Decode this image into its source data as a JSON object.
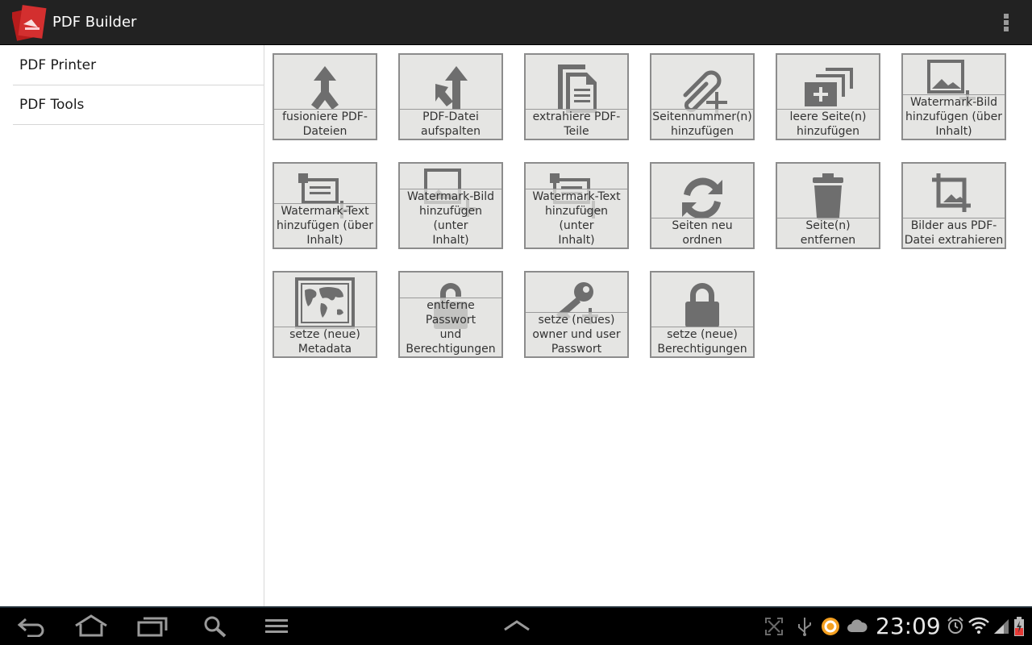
{
  "app": {
    "title": "PDF Builder",
    "icon": "pdf-app-icon"
  },
  "action_bar": {
    "overflow_icon": "overflow-menu-icon"
  },
  "sidebar": {
    "items": [
      {
        "label": "PDF Printer"
      },
      {
        "label": "PDF Tools"
      }
    ]
  },
  "tools": [
    {
      "label": "fusioniere PDF-\nDateien",
      "icon": "merge-icon"
    },
    {
      "label": "PDF-Datei\naufspalten",
      "icon": "split-icon"
    },
    {
      "label": "extrahiere PDF-\nTeile",
      "icon": "extract-pages-icon"
    },
    {
      "label": "Seitennummer(n)\nhinzufügen",
      "icon": "paperclip-add-icon"
    },
    {
      "label": "leere Seite(n)\nhinzufügen",
      "icon": "add-blank-page-icon"
    },
    {
      "label": "Watermark-Bild\nhinzufügen (über\nInhalt)",
      "icon": "image-watermark-icon"
    },
    {
      "label": "Watermark-Text\nhinzufügen (über\nInhalt)",
      "icon": "text-watermark-icon"
    },
    {
      "label": "Watermark-Bild\nhinzufügen (unter\nInhalt)",
      "icon": "image-watermark-icon"
    },
    {
      "label": "Watermark-Text\nhinzufügen (unter\nInhalt)",
      "icon": "text-watermark-icon"
    },
    {
      "label": "Seiten neu ordnen",
      "icon": "reorder-icon"
    },
    {
      "label": "Seite(n) entfernen",
      "icon": "trash-icon"
    },
    {
      "label": "Bilder aus PDF-\nDatei extrahieren",
      "icon": "crop-image-icon"
    },
    {
      "label": "setze (neue)\nMetadata",
      "icon": "world-map-icon"
    },
    {
      "label": "entferne Passwort\nund\nBerechtigungen",
      "icon": "unlock-icon"
    },
    {
      "label": "setze (neues)\nowner und user\nPasswort",
      "icon": "key-icon"
    },
    {
      "label": "setze (neue)\nBerechtigungen",
      "icon": "lock-icon"
    }
  ],
  "system_bar": {
    "time": "23:09",
    "nav_icons": [
      "back-icon",
      "home-icon",
      "recent-apps-icon",
      "search-icon",
      "menu-icon",
      "chevron-up-icon"
    ],
    "status_icons": [
      "fullscreen-icon",
      "usb-icon",
      "sync-app-icon",
      "cloud-icon",
      "alarm-icon",
      "wifi-icon",
      "signal-icon",
      "battery-charging-icon"
    ]
  }
}
